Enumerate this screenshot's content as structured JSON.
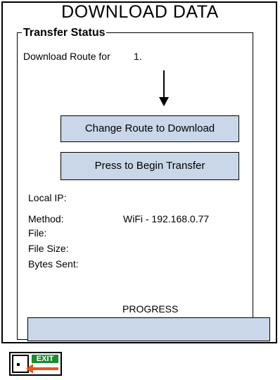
{
  "window_title": "DOWNLOAD DATA",
  "transfer_status": {
    "group_title": "Transfer Status",
    "route_label": "Download Route for",
    "route_value": "1.",
    "change_route_button": "Change Route to Download",
    "begin_transfer_button": "Press to Begin Transfer",
    "local_ip_label": "Local IP:",
    "local_ip_value": "",
    "method_label": "Method:",
    "method_value": "WiFi - 192.168.0.77",
    "file_label": "File:",
    "file_value": "",
    "file_size_label": "File Size:",
    "file_size_value": "",
    "bytes_sent_label": "Bytes Sent:",
    "bytes_sent_value": "",
    "progress_label": "PROGRESS",
    "progress_fraction": 0
  },
  "exit": {
    "label": "EXIT",
    "icon": "exit-door-icon",
    "colors": {
      "sign": "#1f8a32",
      "arrow": "#e4571b"
    }
  },
  "colors": {
    "button_fill": "#c9d7e8"
  }
}
